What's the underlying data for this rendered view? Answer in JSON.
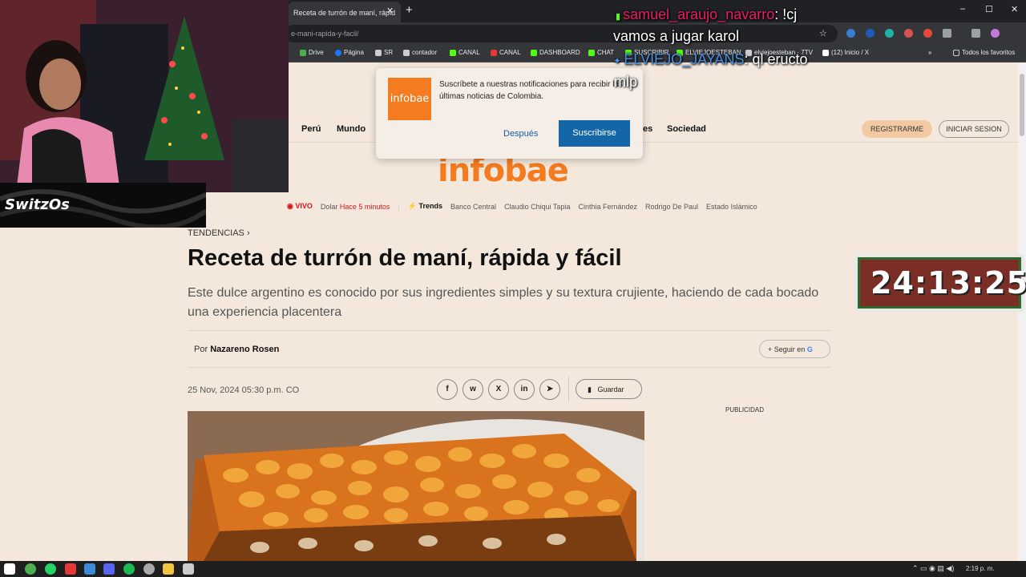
{
  "browser": {
    "tab_title": "Receta de turrón de maní, rápid",
    "tab_close": "✕",
    "new_tab": "+",
    "url": "e-mani-rapida-y-facil/",
    "window": {
      "minimize": "–",
      "maximize": "☐",
      "close": "✕"
    },
    "bookmarks": [
      {
        "label": "Drive",
        "color": "#4caf50"
      },
      {
        "label": "Página",
        "color": "#1877f2"
      },
      {
        "label": "SR",
        "color": "#cccccc"
      },
      {
        "label": "contador",
        "color": "#cccccc"
      },
      {
        "label": "CANAL",
        "color": "#53fc18"
      },
      {
        "label": "CANAL",
        "color": "#e53935"
      },
      {
        "label": "DASHBOARD",
        "color": "#53fc18"
      },
      {
        "label": "CHAT",
        "color": "#53fc18"
      },
      {
        "label": "SUSCRIBIR",
        "color": "#53fc18"
      },
      {
        "label": "ELVIEJOESTEBAN",
        "color": "#53fc18"
      },
      {
        "label": "elviejoesteban · 7TV",
        "color": "#cccccc"
      },
      {
        "label": "(12) Inicio / X",
        "color": "#ffffff"
      }
    ],
    "bookmarks_more": "»",
    "all_favorites": "Todos los favoritos"
  },
  "site": {
    "nav": [
      "Perú",
      "Mundo",
      "es",
      "Sociedad"
    ],
    "register": "REGISTRARME",
    "login": "INICIAR SESION",
    "logo": "infobae",
    "subnav": {
      "live": "VIVO",
      "dolar": "Dolar",
      "dolar_time": "Hace 5 minutos",
      "trends": "Trends",
      "links": [
        "Banco Central",
        "Claudio Chiqui Tapia",
        "Cinthia Fernández",
        "Rodrigo De Paul",
        "Estado Islámico"
      ]
    }
  },
  "article": {
    "breadcrumb": "TENDENCIAS ›",
    "title": "Receta de turrón de maní, rápida y fácil",
    "subtitle": "Este dulce argentino es conocido por sus ingredientes simples y su textura crujiente, haciendo de cada bocado una experiencia placentera",
    "by_prefix": "Por",
    "author": "Nazareno Rosen",
    "follow": "Seguir en",
    "follow_g": "G",
    "date": "25 Nov, 2024 05:30 p.m. CO",
    "share": [
      "f",
      "w",
      "X",
      "in",
      "➤"
    ],
    "save": "Guardar",
    "ad_label": "PUBLICIDAD"
  },
  "notification": {
    "logo": "infobae",
    "text": "Suscríbete a nuestras notificaciones para recibir las últimas noticias de Colombia.",
    "later": "Después",
    "subscribe": "Suscribirse"
  },
  "stream": {
    "channel_logo": "SwitzOs",
    "chat": [
      {
        "user": "samuel_araujo_navarro",
        "text": ": !cj"
      },
      {
        "user": "",
        "text": "vamos a jugar karol"
      },
      {
        "user": "ELVIEJO_JAYANS",
        "text": ": ql eructo"
      },
      {
        "user": "",
        "text": "mlp"
      }
    ],
    "timer": "24:13:25"
  },
  "taskbar": {
    "clock": "2:19 p. m."
  }
}
